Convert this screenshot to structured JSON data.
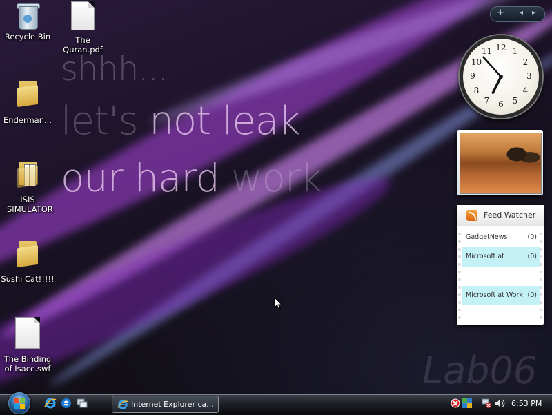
{
  "wallpaper": {
    "line1": "shhh...",
    "line2_pre": "let's ",
    "line2_hl": "not leak",
    "line3_hl": "our hard",
    "line3_post": " work",
    "watermark": "Lab06"
  },
  "desktop_icons": [
    {
      "label": "Recycle Bin",
      "icon": "recycle-bin-icon"
    },
    {
      "label": "The Quran.pdf",
      "icon": "document-icon"
    },
    {
      "label": "Enderman...",
      "icon": "folder-icon"
    },
    {
      "label": "ISIS SIMULATOR",
      "icon": "folder-icon"
    },
    {
      "label": "Sushi Cat!!!!!",
      "icon": "folder-icon"
    },
    {
      "label": "The Binding of Isacc.swf",
      "icon": "document-icon"
    }
  ],
  "sidebar_controls": {
    "add": "+",
    "prev": "◂",
    "next": "▸"
  },
  "clock_gadget": {
    "numbers": [
      "12",
      "1",
      "2",
      "3",
      "4",
      "5",
      "6",
      "7",
      "8",
      "9",
      "10",
      "11"
    ],
    "hour": 6,
    "minute": 53
  },
  "feed_watcher": {
    "title": "Feed Watcher",
    "items": [
      {
        "name": "GadgetNews",
        "count": "(0)",
        "highlight": false
      },
      {
        "name": "Microsoft at",
        "count": "(0)",
        "highlight": true
      },
      {
        "name": "",
        "count": "",
        "highlight": false
      },
      {
        "name": "Microsoft at Work",
        "count": "(0)",
        "highlight": true
      },
      {
        "name": "",
        "count": "",
        "highlight": false
      }
    ]
  },
  "taskbar": {
    "quick_launch": [
      "internet-explorer-icon",
      "ie-alt-icon",
      "switch-windows-icon"
    ],
    "window_button": "Internet Explorer ca...",
    "tray_icons": [
      "security-alert-icon",
      "network-icon",
      "no-network-icon",
      "volume-icon"
    ],
    "clock": "6:53 PM"
  },
  "colors": {
    "accent": "#c080e0",
    "feed_highlight": "#c4f1f6",
    "taskbar": "#1b1e24"
  }
}
